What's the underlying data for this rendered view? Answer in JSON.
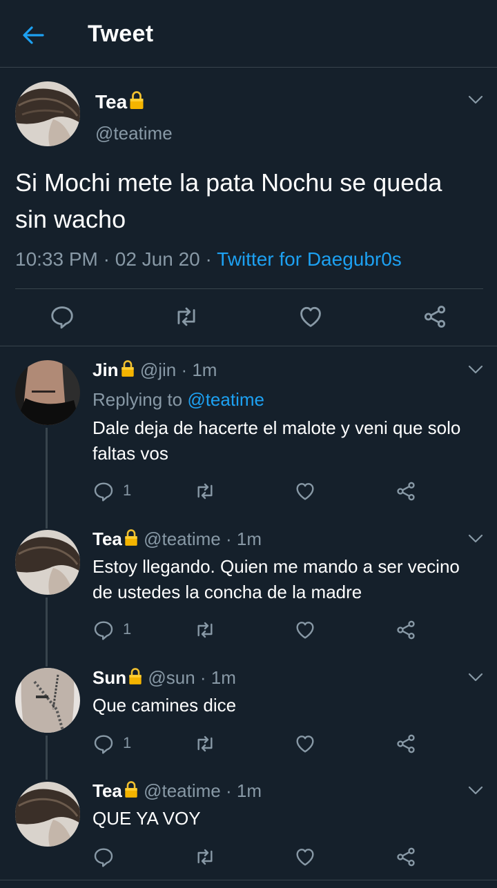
{
  "header": {
    "title": "Tweet"
  },
  "main_tweet": {
    "name": "Tea",
    "handle": "@teatime",
    "text": "Si Mochi mete la pata Nochu se queda sin wacho",
    "time": "10:33 PM",
    "sep1": " · ",
    "date": "02 Jun 20",
    "sep2": " · ",
    "source": "Twitter for Daegubr0s"
  },
  "replies": [
    {
      "name": "Jin",
      "handle": "@jin",
      "dot": " · ",
      "time": "1m",
      "replying_label": "Replying to ",
      "replying_to": "@teatime",
      "text": "Dale deja de hacerte el malote y veni que solo faltas vos",
      "reply_count": "1"
    },
    {
      "name": "Tea",
      "handle": "@teatime",
      "dot": " · ",
      "time": "1m",
      "text": "Estoy llegando. Quien me mando a ser vecino de ustedes la concha de la madre",
      "reply_count": "1"
    },
    {
      "name": "Sun",
      "handle": "@sun",
      "dot": " · ",
      "time": "1m",
      "text": "Que camines dice",
      "reply_count": "1"
    },
    {
      "name": "Tea",
      "handle": "@teatime",
      "dot": " · ",
      "time": "1m",
      "text": "QUE YA VOY",
      "reply_count": ""
    }
  ],
  "colors": {
    "background": "#15202b",
    "accent": "#1da1f2",
    "secondary_text": "#8899a6",
    "divider": "#38444d",
    "lock": "#f4b400"
  }
}
